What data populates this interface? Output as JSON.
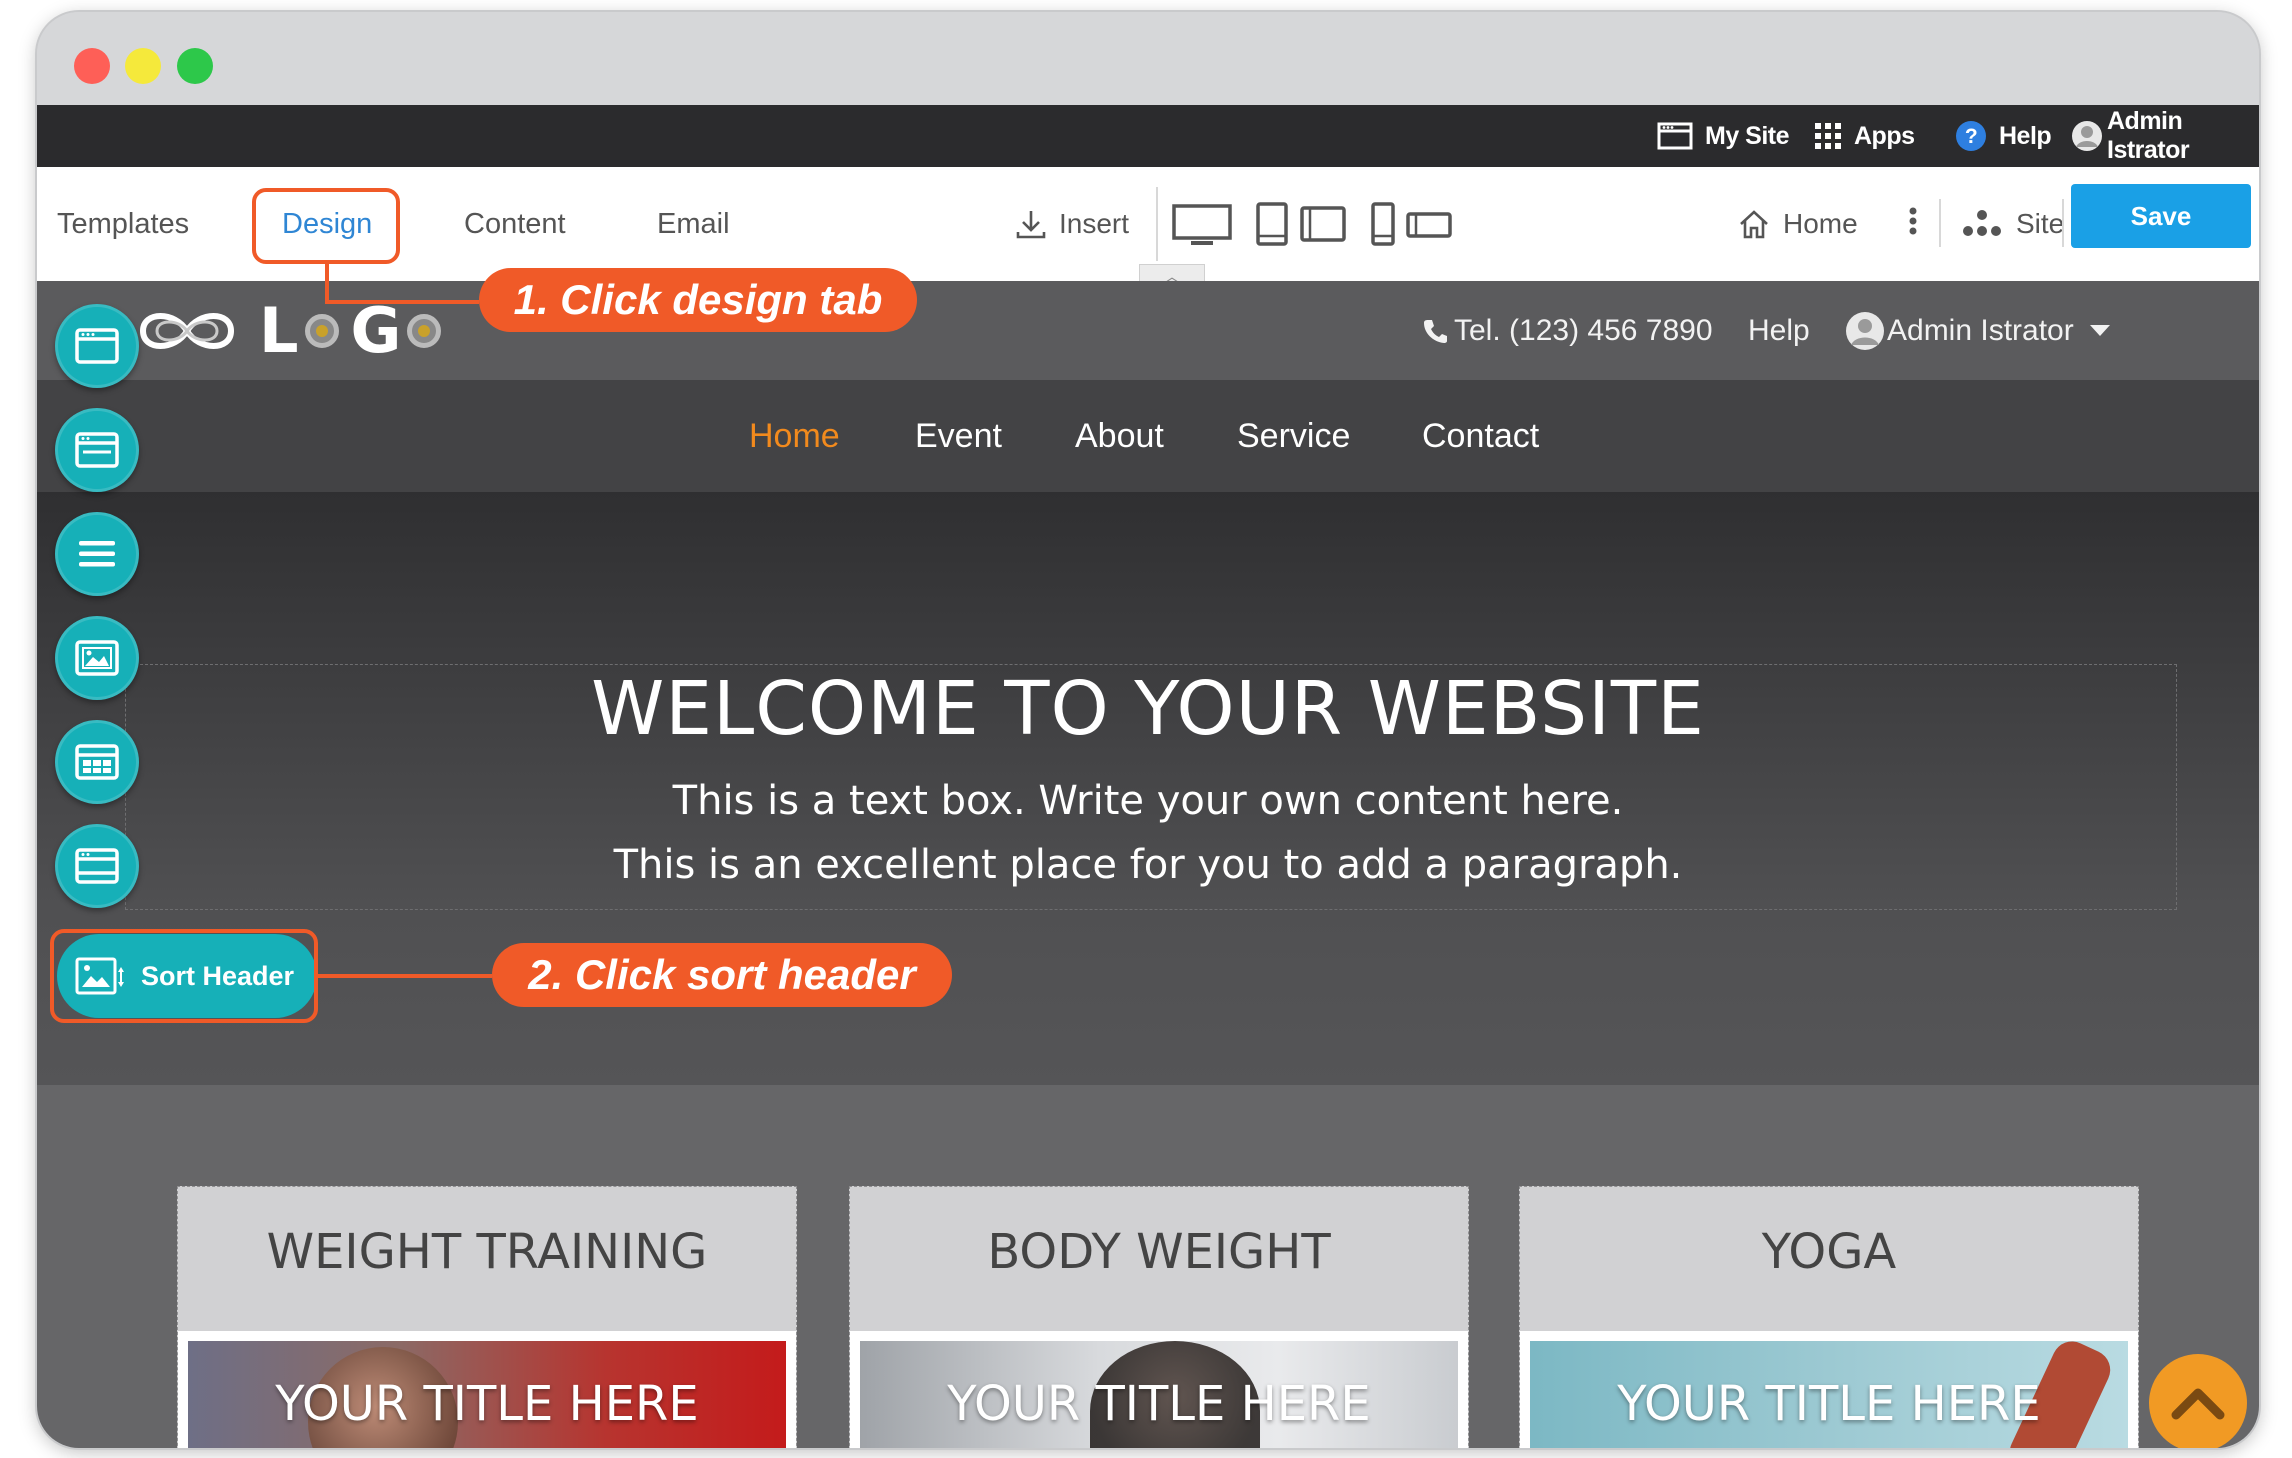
{
  "adminbar": {
    "my_site": "My Site",
    "apps": "Apps",
    "help": "Help",
    "user": "Admin Istrator"
  },
  "toolbar": {
    "tabs": [
      "Templates",
      "Design",
      "Content",
      "Email"
    ],
    "active_tab": "Design",
    "insert": "Insert",
    "home": "Home",
    "site": "Site",
    "save": "Save"
  },
  "site": {
    "logo_letters": [
      "L",
      "G"
    ],
    "phone": "Tel. (123) 456 7890",
    "help": "Help",
    "user": "Admin Istrator",
    "nav": [
      "Home",
      "Event",
      "About",
      "Service",
      "Contact"
    ],
    "active_nav": "Home",
    "hero": {
      "title": "WELCOME TO YOUR WEBSITE",
      "line1": "This is a text box. Write your own content here.",
      "line2": "This is an excellent place for you to add a paragraph."
    },
    "cards": [
      {
        "title": "WEIGHT TRAINING",
        "image_title": "YOUR TITLE HERE"
      },
      {
        "title": "BODY WEIGHT",
        "image_title": "YOUR TITLE HERE"
      },
      {
        "title": "YOGA",
        "image_title": "YOUR TITLE HERE"
      }
    ]
  },
  "sidebar": {
    "sort_header": "Sort Header"
  },
  "annotations": {
    "step1": "1. Click design tab",
    "step2": "2. Click sort header"
  },
  "colors": {
    "accent_blue": "#1aa0e6",
    "active_tab": "#2f86d4",
    "nav_active": "#f28a1d",
    "teal": "#16b0b8",
    "callout": "#f05a28"
  }
}
